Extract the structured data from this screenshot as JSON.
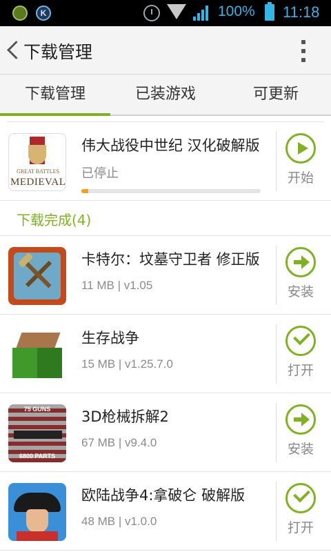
{
  "status_bar": {
    "battery_pct": "100%",
    "time": "11:18",
    "left_icon_2_letter": "K"
  },
  "header": {
    "title": "下载管理"
  },
  "tabs": [
    {
      "label": "下载管理",
      "active": true
    },
    {
      "label": "已装游戏",
      "active": false
    },
    {
      "label": "可更新",
      "active": false
    }
  ],
  "downloading": {
    "name": "伟大战役中世纪 汉化破解版",
    "status": "已停止",
    "progress": 0.04,
    "action": "开始",
    "thumb_text_small": "GREAT BATTLES",
    "thumb_text_big": "MEDIEVAL"
  },
  "completed_header": "下载完成(4)",
  "completed": [
    {
      "name": "卡特尔：坟墓守卫者 修正版",
      "meta": "11 MB | v1.05",
      "action": "安装",
      "icon": "arrow-right-icon"
    },
    {
      "name": "生存战争",
      "meta": "15 MB | v1.25.7.0",
      "action": "打开",
      "icon": "check-icon"
    },
    {
      "name": "3D枪械拆解2",
      "meta": "67 MB | v9.4.0",
      "action": "安装",
      "icon": "arrow-right-icon",
      "thumb_top": "75 GUNS",
      "thumb_bottom": "6800 PARTS"
    },
    {
      "name": "欧陆战争4:拿破仑 破解版",
      "meta": "48 MB | v1.0.0",
      "action": "打开",
      "icon": "check-icon"
    }
  ],
  "colors": {
    "accent": "#7fb21f",
    "status_blue": "#33b5e5",
    "progress": "#f2a31b"
  }
}
